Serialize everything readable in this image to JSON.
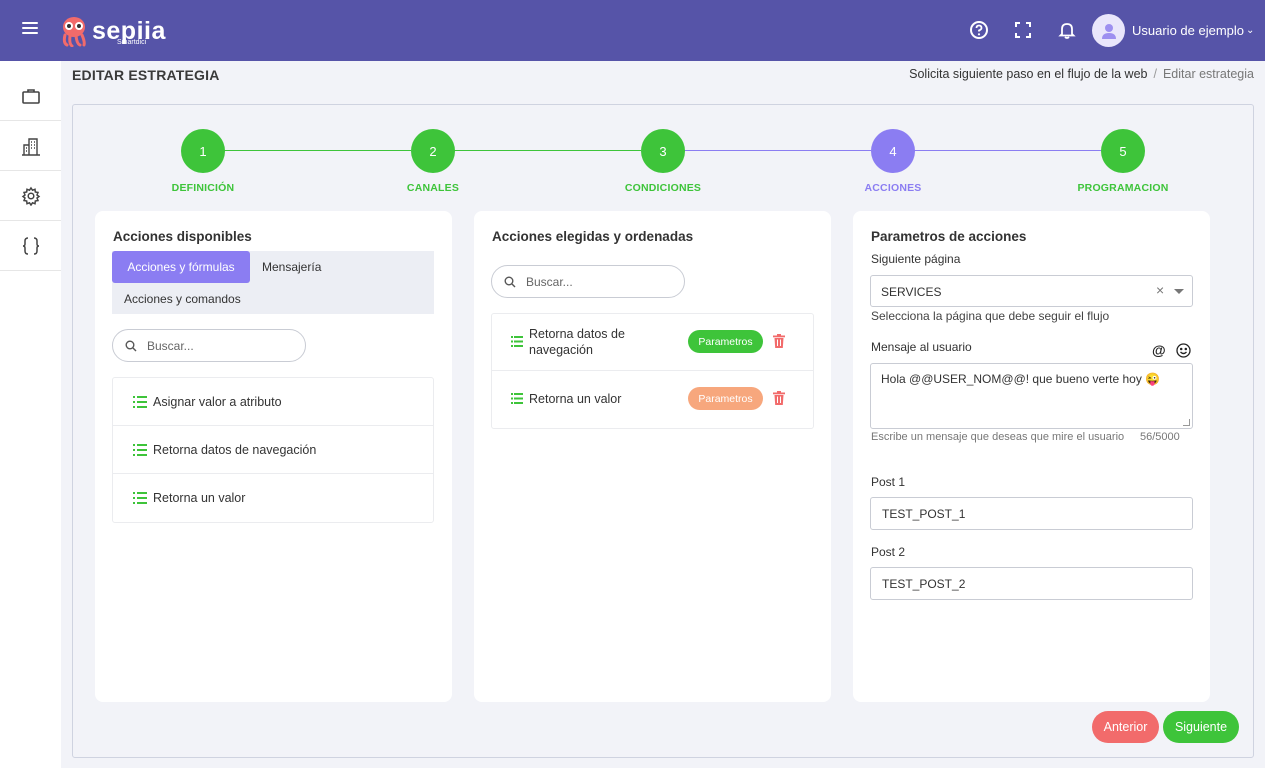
{
  "app": {
    "logo_text": "sepiia",
    "logo_subtext": "Smartdici",
    "user_name": "Usuario de ejemplo"
  },
  "header": {
    "title": "EDITAR ESTRATEGIA",
    "breadcrumb": [
      "Solicita siguiente paso en el flujo de la web",
      "Editar estrategia"
    ]
  },
  "icons": {
    "topbar": [
      "menu-icon",
      "help-icon",
      "fullscreen-icon",
      "bell-icon",
      "user-avatar-icon",
      "chevron-down-icon"
    ],
    "sidebar": [
      "briefcase-icon",
      "building-icon",
      "gear-icon",
      "code-braces-icon"
    ]
  },
  "stepper": {
    "steps": [
      {
        "number": "1",
        "label": "DEFINICIÓN",
        "state": "done"
      },
      {
        "number": "2",
        "label": "CANALES",
        "state": "done"
      },
      {
        "number": "3",
        "label": "CONDICIONES",
        "state": "done"
      },
      {
        "number": "4",
        "label": "ACCIONES",
        "state": "current"
      },
      {
        "number": "5",
        "label": "PROGRAMACION",
        "state": "done"
      }
    ]
  },
  "available": {
    "title": "Acciones disponibles",
    "tabs": [
      "Acciones y fórmulas",
      "Mensajería",
      "Acciones y comandos"
    ],
    "active_tab": "Acciones y fórmulas",
    "search_placeholder": "Buscar...",
    "items": [
      "Asignar valor a atributo",
      "Retorna datos de navegación",
      "Retorna un valor"
    ]
  },
  "chosen": {
    "title": "Acciones elegidas y ordenadas",
    "search_placeholder": "Buscar...",
    "items": [
      {
        "label": "Retorna datos de navegación",
        "button": "Parametros",
        "button_color": "#3ec43a"
      },
      {
        "label": "Retorna un valor",
        "button": "Parametros",
        "button_color": "#f7a77d"
      }
    ]
  },
  "params": {
    "title": "Parametros de acciones",
    "next_page_label": "Siguiente página",
    "next_page_value": "SERVICES",
    "next_page_help": "Selecciona la página que debe seguir el flujo",
    "message_label": "Mensaje al usuario",
    "message_value": "Hola @@USER_NOM@@! que bueno verte hoy 😜",
    "message_help": "Escribe un mensaje que deseas que mire el usuario",
    "message_count": "56/5000",
    "post1_label": "Post 1",
    "post1_value": "TEST_POST_1",
    "post2_label": "Post 2",
    "post2_value": "TEST_POST_2"
  },
  "footer": {
    "prev_label": "Anterior",
    "next_label": "Siguiente"
  },
  "colors": {
    "topbar": "#5654a8",
    "accent": "#8b7df2",
    "success": "#3ec43a",
    "danger": "#f26b6b",
    "warning": "#f7a77d"
  }
}
